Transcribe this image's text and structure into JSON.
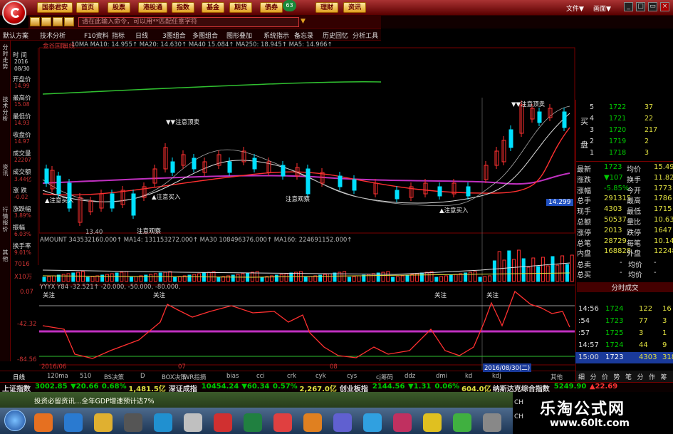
{
  "menu": {
    "buttons": [
      "国泰君安",
      "首页",
      "股票",
      "港股通",
      "指数",
      "基金",
      "期货",
      "债券",
      "理财",
      "资讯"
    ],
    "badge": "63",
    "file_menu": "文件▼",
    "view_menu": "画面▼"
  },
  "search": {
    "placeholder": "请在此输入命令，可以用**匹配任意字符"
  },
  "toolbar": [
    "默认方案",
    "技术分析",
    "F10资料",
    "指标",
    "日线",
    "3图组合",
    "多图组合",
    "图形叠加",
    "系统指示",
    "备忘录",
    "历史回忆",
    "分析工具"
  ],
  "sidebar_tabs": [
    "分时走势",
    "技术分析",
    "资讯",
    "行情报价",
    "其他"
  ],
  "info": {
    "time_label": "时 间",
    "date": "2016",
    "date2": "08/30",
    "open_label": "开盘价",
    "open": "14.99",
    "high_label": "最高价",
    "high": "15.08",
    "low_label": "最低价",
    "low": "14.93",
    "close_label": "收盘价",
    "close": "14.97",
    "vol_label": "成交量",
    "vol": "22207",
    "amt_label": "成交额",
    "amt": "3.44亿",
    "chg_label": "涨 跌",
    "chg": "-0.02",
    "pct_label": "涨跌幅",
    "pct": "3.89%",
    "amp_label": "振幅",
    "amp": "6.03%",
    "turn_label": "换手率",
    "turn": "9.01%"
  },
  "chart": {
    "stock_name": "金谷国际",
    "period": "日线",
    "ma_line": "10MA MA10: 14.955↑ MA20: 14.630↑ MA40 15.084↑ MA250: 18.945↑ MA5: 14.966↑",
    "price_label": "14.299",
    "low_mark": "13.40",
    "year_mark": "2016/06",
    "mid_mark": "07",
    "mid_mark2": "08",
    "cursor_date": "2016/08/30(二)",
    "vol_line": "AMOUNT 343532160.000↑ MA14: 131153272.000↑ MA30 108496376.000↑ MA160: 224691152.000↑",
    "vol_label": "7016",
    "vol_label2": "X10万",
    "ind_line": "YYYX Y84 -32.521↑ -20.000, -50.000, -80.000,",
    "ind_top": "0.07",
    "ind_mid": "-42.32",
    "ind_bot": "-84.56",
    "annotations": {
      "sell_top": "▼▼注意顶卖",
      "sell_right": "▼▼注意顶卖",
      "buy1": "▲注意买入",
      "buy2": "▲注意买入",
      "buy3": "▲注意买入",
      "watch1": "注意观察",
      "watch2": "注意观察",
      "focus1": "关注",
      "focus2": "关注",
      "focus3": "关注",
      "focus4": "关注"
    }
  },
  "orderbook": {
    "rows": [
      [
        "5",
        "1722",
        "37"
      ],
      [
        "4",
        "1721",
        "22"
      ],
      [
        "3",
        "1720",
        "217"
      ],
      [
        "2",
        "1719",
        "2"
      ],
      [
        "1",
        "1718",
        "3"
      ]
    ],
    "buy_label": "买",
    "pan_label": "盘"
  },
  "quote": [
    [
      "最新",
      "1723",
      "均价",
      "15.49"
    ],
    [
      "涨跌",
      "▼107",
      "换手",
      "11.82%"
    ],
    [
      "涨幅",
      "-5.85%",
      "今开",
      "1773"
    ],
    [
      "总手",
      "291315",
      "最高",
      "1786"
    ],
    [
      "现手",
      "4303",
      "最低",
      "1715"
    ],
    [
      "总额",
      "50537",
      "量比",
      "10.63"
    ],
    [
      "涨停",
      "2013",
      "跌停",
      "1647"
    ],
    [
      "总笔",
      "28729",
      "每笔",
      "10.14"
    ],
    [
      "内盘",
      "168828",
      "外盘",
      "122487"
    ]
  ],
  "extra": [
    [
      "总卖",
      "-",
      "均价",
      "-"
    ],
    [
      "总买",
      "-",
      "均价",
      "-"
    ]
  ],
  "trades_title": "分时成交",
  "trades": [
    [
      "14:56",
      "1724",
      "122",
      "16"
    ],
    [
      ":54",
      "1723",
      "77",
      "3"
    ],
    [
      ":57",
      "1725",
      "3",
      "1"
    ],
    [
      "14:57",
      "1724",
      "44",
      "9"
    ],
    [
      "15:00",
      "1723",
      "4303",
      "318"
    ]
  ],
  "bottom_tabs": [
    "日线",
    "120ma",
    "510",
    "BS决策",
    "D",
    "BOX决策",
    "WR指摘",
    "bias",
    "cci",
    "crk",
    "cyk",
    "cys",
    "cj筹码",
    "ddz",
    "dmi",
    "kd",
    "kdj",
    "其他"
  ],
  "right_tabs": [
    "细",
    "分",
    "价",
    "势",
    "笔",
    "分",
    "作",
    "筹"
  ],
  "ticker": [
    [
      "上证指数",
      "3002.85",
      "▼20.66",
      "0.68%",
      "1,481.5亿"
    ],
    [
      "深证成指",
      "10454.24",
      "▼60.34",
      "0.57%",
      "2,267.0亿"
    ],
    [
      "创业板指",
      "2144.56",
      "▼1.31",
      "0.06%",
      "604.0亿"
    ],
    [
      "纳斯达克综合指数",
      "5249.90",
      "▲22.69"
    ]
  ],
  "news": "投资必留资讯…全年GDP增速预计达7%",
  "watermark": {
    "cn": "乐淘公式网",
    "url": "www.60lt.com"
  },
  "colors": {
    "up": "#ff3030",
    "down": "#00e0ff",
    "ma_green": "#30c030",
    "ma_purple": "#c030c0",
    "ma_red": "#ff3030",
    "ma_white": "#dddddd",
    "ma_yellow": "#e0e040"
  }
}
